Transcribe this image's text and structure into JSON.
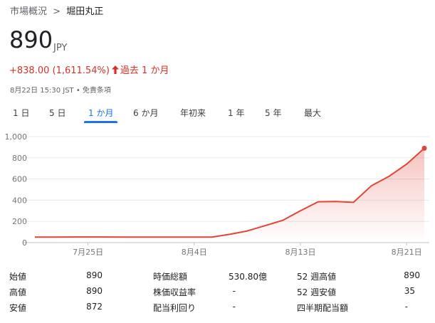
{
  "breadcrumb": {
    "parent": "市場概況",
    "separator": ">",
    "current": "堀田丸正"
  },
  "quote": {
    "price": "890",
    "currency": "JPY",
    "change": "+838.00 (1,611.54%)",
    "period": "過去 1 か月",
    "timestamp": "8月22日 15:30 JST • 免責条項"
  },
  "tabs": [
    {
      "label": "1 日"
    },
    {
      "label": "5 日"
    },
    {
      "label": "1 か月",
      "active": true
    },
    {
      "label": "6 か月"
    },
    {
      "label": "年初来"
    },
    {
      "label": "1 年"
    },
    {
      "label": "5 年"
    },
    {
      "label": "最大"
    }
  ],
  "colors": {
    "line": "#e04436",
    "accent": "#1a73e8",
    "negative": "#d93025"
  },
  "chart_data": {
    "type": "area",
    "y_ticks": [
      "1,000",
      "800",
      "600",
      "400",
      "200",
      "0"
    ],
    "ylim": [
      0,
      1000
    ],
    "x_tick_labels": [
      "7月25日",
      "8月4日",
      "8月13日",
      "8月21日"
    ],
    "x": [
      "7/22",
      "7/23",
      "7/24",
      "7/25",
      "7/26",
      "7/29",
      "7/30",
      "7/31",
      "8/1",
      "8/2",
      "8/5",
      "8/6",
      "8/7",
      "8/8",
      "8/9",
      "8/13",
      "8/14",
      "8/15",
      "8/16",
      "8/19",
      "8/20",
      "8/21",
      "8/22"
    ],
    "values": [
      52,
      52,
      53,
      53,
      53,
      52,
      52,
      52,
      52,
      52,
      52,
      78,
      110,
      160,
      210,
      300,
      385,
      388,
      380,
      535,
      625,
      740,
      890
    ],
    "x_tick_index": [
      3,
      9,
      15,
      21
    ],
    "grid": true
  },
  "stats": [
    [
      {
        "label": "始値",
        "value": "890"
      },
      {
        "label": "時価総額",
        "value": "530.80億"
      },
      {
        "label": "52 週高値",
        "value": "890"
      }
    ],
    [
      {
        "label": "高値",
        "value": "890"
      },
      {
        "label": "株価収益率",
        "value": "-"
      },
      {
        "label": "52 週安値",
        "value": "35"
      }
    ],
    [
      {
        "label": "安値",
        "value": "872"
      },
      {
        "label": "配当利回り",
        "value": "-"
      },
      {
        "label": "四半期配当額",
        "value": "-"
      }
    ]
  ]
}
